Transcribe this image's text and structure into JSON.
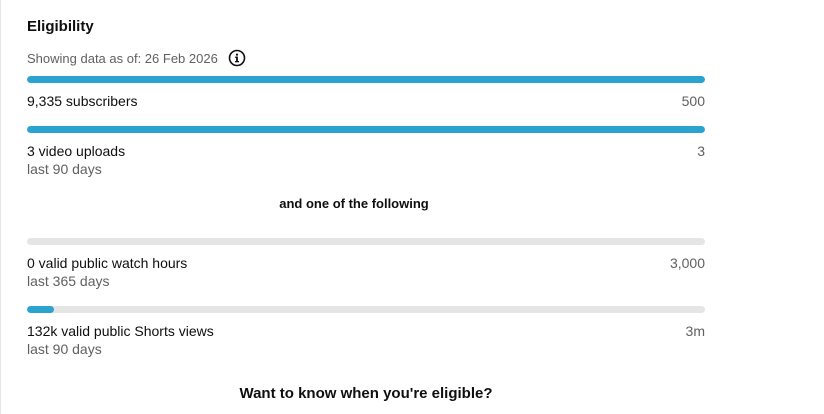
{
  "eligibility": {
    "title": "Eligibility",
    "as_of": "Showing data as of: 26 Feb 2026",
    "info_icon": "info-circle-icon",
    "connector": "and one of the following",
    "cta": "Want to know when you're eligible?",
    "accent_color": "#2aa4cf",
    "track_color": "#e5e5e5",
    "metrics": [
      {
        "label": "9,335 subscribers",
        "target": "500",
        "sub": "",
        "progress": 1.0
      },
      {
        "label": "3 video uploads",
        "target": "3",
        "sub": "last 90 days",
        "progress": 1.0
      },
      {
        "label": "0 valid public watch hours",
        "target": "3,000",
        "sub": "last 365 days",
        "progress": 0.0
      },
      {
        "label": "132k valid public Shorts views",
        "target": "3m",
        "sub": "last 90 days",
        "progress": 0.04
      }
    ]
  }
}
